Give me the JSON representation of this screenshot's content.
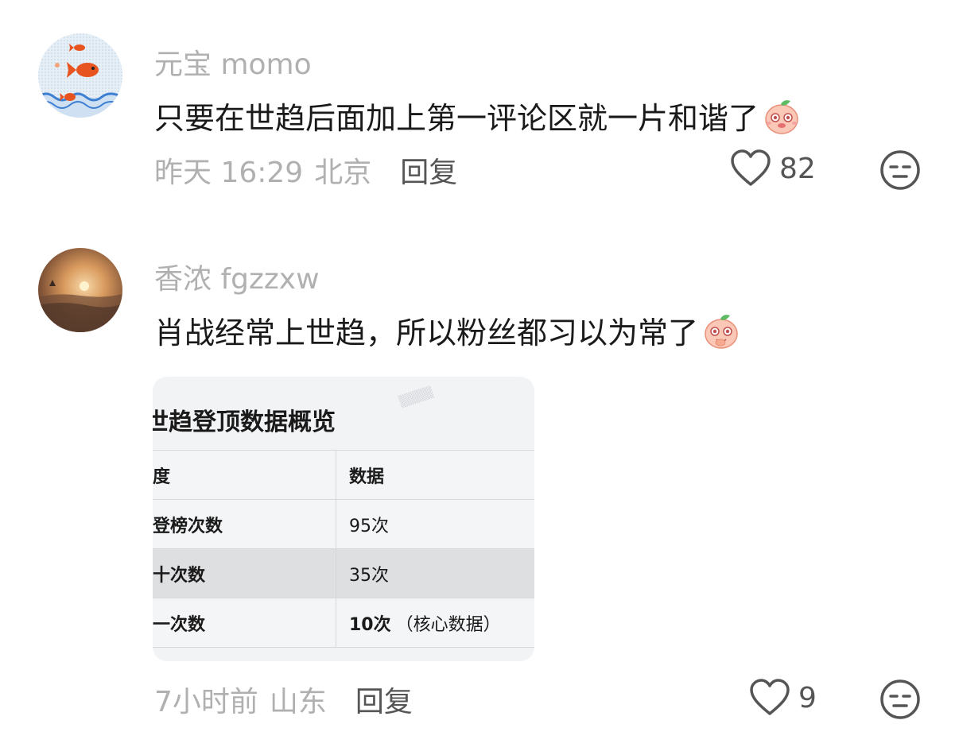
{
  "comments": [
    {
      "username": "元宝 momo",
      "text": "只要在世趋后面加上第一评论区就一片和谐了",
      "time": "昨天 16:29",
      "location": "北京",
      "reply_label": "回复",
      "likes": "82",
      "icons": {
        "avatar": "goldfish-avatar",
        "emoji": "peach-emoji",
        "like": "heart-icon",
        "dislike": "meh-face-icon"
      }
    },
    {
      "username": "香浓 fgzzxw",
      "text": "肖战经常上世趋，所以粉丝都习以为常了",
      "time": "7小时前",
      "location": "山东",
      "reply_label": "回复",
      "likes": "9",
      "icons": {
        "avatar": "sunset-avatar",
        "emoji": "peach-emoji",
        "like": "heart-icon",
        "dislike": "meh-face-icon"
      },
      "attached_image": {
        "title": "世趋登顶数据概览",
        "headers": [
          "度",
          "数据"
        ],
        "rows": [
          {
            "label": "登榜次数",
            "value": "95次",
            "note": ""
          },
          {
            "label": "十次数",
            "value": "35次",
            "note": ""
          },
          {
            "label": "一次数",
            "value": "10次",
            "note": "（核心数据）"
          }
        ]
      }
    }
  ],
  "colors": {
    "secondary_text": "#b0b0b0",
    "primary_text": "#1a1a1a",
    "action_text": "#555555"
  }
}
